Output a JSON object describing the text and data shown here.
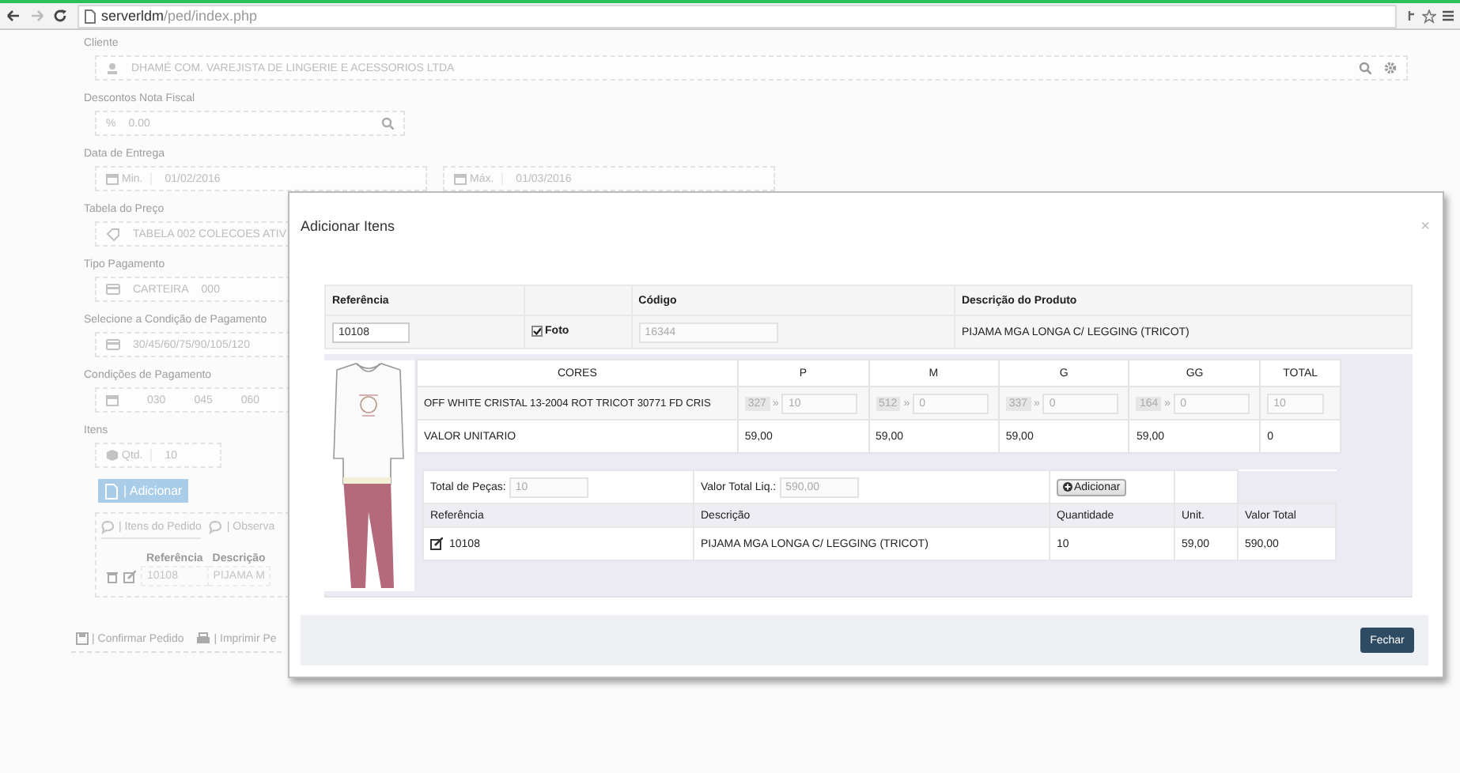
{
  "browser": {
    "url_host": "serverldm",
    "url_path": "/ped/index.php"
  },
  "form": {
    "cliente": {
      "label": "Cliente",
      "value": "DHAMÉ COM. VAREJISTA DE LINGERIE E ACESSORIOS LTDA"
    },
    "descontos": {
      "label": "Descontos Nota Fiscal",
      "prefix": "%",
      "value": "0.00"
    },
    "data_entrega": {
      "label": "Data de Entrega",
      "min_label": "Min.",
      "min_value": "01/02/2016",
      "max_label": "Máx.",
      "max_value": "01/03/2016"
    },
    "tabela_preco": {
      "label": "Tabela do Preço",
      "value": "TABELA 002 COLECOES ATIV"
    },
    "tipo_pagamento": {
      "label": "Tipo Pagamento",
      "value": "CARTEIRA",
      "code": "000"
    },
    "condicao": {
      "label": "Selecione a Condição de Pagamento",
      "value": "30/45/60/75/90/105/120"
    },
    "condicoes_pagamento": {
      "label": "Condições de Pagamento",
      "values": [
        "030",
        "045",
        "060"
      ]
    },
    "itens": {
      "label": "Itens",
      "qty_label": "Qtd.",
      "qty_value": "10",
      "add_button": "| Adicionar",
      "tabs": [
        {
          "label": "| Itens do Pedido",
          "selected": true
        },
        {
          "label": "| Observa",
          "selected": false
        }
      ],
      "columns": [
        "Referência",
        "Descrição"
      ],
      "rows": [
        [
          "10108",
          "PIJAMA M"
        ]
      ]
    },
    "actions": [
      "| Confirmar Pedido",
      "| Imprimir Pe"
    ]
  },
  "modal": {
    "title": "Adicionar Itens",
    "close": "×",
    "product": {
      "ref_label": "Referência",
      "code_label": "Código",
      "desc_label": "Descrição do Produto",
      "ref_value": "10108",
      "photo_label": "Foto",
      "photo_checked": true,
      "code_value": "16344",
      "desc_value": "PIJAMA MGA LONGA C/ LEGGING (TRICOT)"
    },
    "grid": {
      "columns": [
        "CORES",
        "P",
        "M",
        "G",
        "GG",
        "TOTAL"
      ],
      "separator": "»",
      "color_row": {
        "name": "OFF WHITE CRISTAL 13-2004 ROT TRICOT 30771 FD CRIS",
        "sizes": [
          {
            "stock": "327",
            "qty": "10"
          },
          {
            "stock": "512",
            "qty": "0"
          },
          {
            "stock": "337",
            "qty": "0"
          },
          {
            "stock": "164",
            "qty": "0"
          }
        ],
        "total": "10"
      },
      "price_row": {
        "label": "VALOR UNITARIO",
        "prices": [
          "59,00",
          "59,00",
          "59,00",
          "59,00"
        ],
        "total": "0"
      }
    },
    "summary": {
      "pieces_label": "Total de Peças:",
      "pieces_value": "10",
      "value_label": "Valor Total Liq.:",
      "value_value": "590,00",
      "add_button": "Adicionar"
    },
    "items": {
      "columns": [
        "Referência",
        "Descrição",
        "Quantidade",
        "Unit.",
        "Valor Total"
      ],
      "rows": [
        [
          "10108",
          "PIJAMA MGA LONGA C/ LEGGING (TRICOT)",
          "10",
          "59,00",
          "590,00"
        ]
      ]
    },
    "footer_button": "Fechar"
  }
}
